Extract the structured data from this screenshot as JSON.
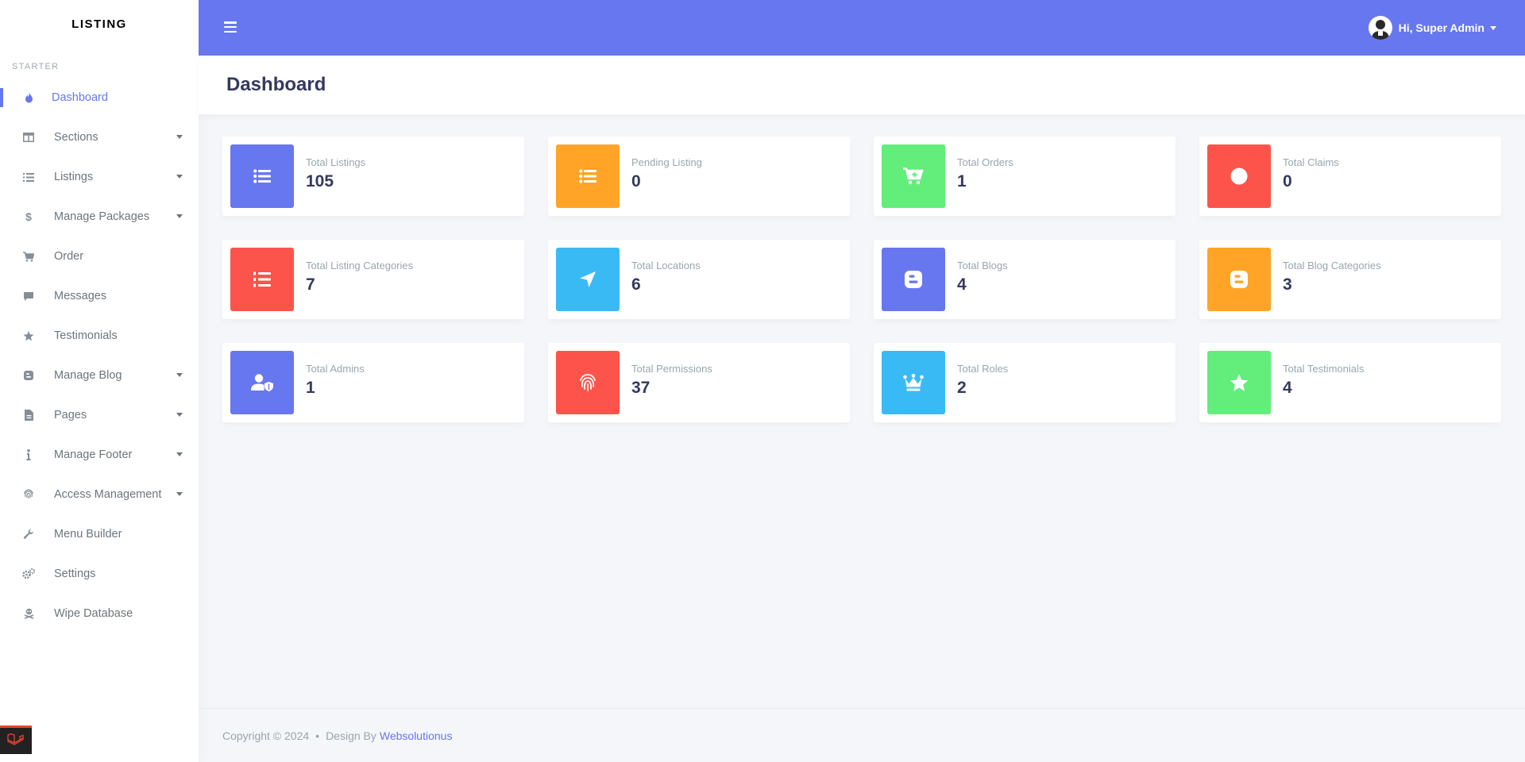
{
  "brand": "LISTING",
  "sidebar": {
    "header": "STARTER",
    "items": [
      {
        "label": "Dashboard",
        "icon": "fire-icon",
        "active": true,
        "dropdown": false
      },
      {
        "label": "Sections",
        "icon": "columns-icon",
        "dropdown": true
      },
      {
        "label": "Listings",
        "icon": "list-icon",
        "dropdown": true
      },
      {
        "label": "Manage Packages",
        "icon": "dollar-icon",
        "dropdown": true
      },
      {
        "label": "Order",
        "icon": "cart-icon",
        "dropdown": false
      },
      {
        "label": "Messages",
        "icon": "comment-icon",
        "dropdown": false
      },
      {
        "label": "Testimonials",
        "icon": "star-icon",
        "dropdown": false
      },
      {
        "label": "Manage Blog",
        "icon": "blog-icon",
        "dropdown": true
      },
      {
        "label": "Pages",
        "icon": "file-icon",
        "dropdown": true
      },
      {
        "label": "Manage Footer",
        "icon": "info-icon",
        "dropdown": true
      },
      {
        "label": "Access Management",
        "icon": "fingerprint-icon",
        "dropdown": true
      },
      {
        "label": "Menu Builder",
        "icon": "wrench-icon",
        "dropdown": false
      },
      {
        "label": "Settings",
        "icon": "cogs-icon",
        "dropdown": false
      },
      {
        "label": "Wipe Database",
        "icon": "skull-icon",
        "dropdown": false
      }
    ]
  },
  "navbar": {
    "greeting": "Hi, Super Admin"
  },
  "page": {
    "title": "Dashboard"
  },
  "cards": [
    {
      "label": "Total Listings",
      "value": "105",
      "color": "#6777ef",
      "icon": "list-icon"
    },
    {
      "label": "Pending Listing",
      "value": "0",
      "color": "#ffa426",
      "icon": "list-icon"
    },
    {
      "label": "Total Orders",
      "value": "1",
      "color": "#63ed7a",
      "icon": "cart-plus-icon"
    },
    {
      "label": "Total Claims",
      "value": "0",
      "color": "#fc544b",
      "icon": "circle-icon"
    },
    {
      "label": "Total Listing Categories",
      "value": "7",
      "color": "#fc544b",
      "icon": "list-ol-icon"
    },
    {
      "label": "Total Locations",
      "value": "6",
      "color": "#3abaf4",
      "icon": "location-arrow-icon"
    },
    {
      "label": "Total Blogs",
      "value": "4",
      "color": "#6777ef",
      "icon": "blogger-icon"
    },
    {
      "label": "Total Blog Categories",
      "value": "3",
      "color": "#ffa426",
      "icon": "blogger-icon"
    },
    {
      "label": "Total Admins",
      "value": "1",
      "color": "#6777ef",
      "icon": "user-shield-icon"
    },
    {
      "label": "Total Permissions",
      "value": "37",
      "color": "#fc544b",
      "icon": "fingerprint-icon"
    },
    {
      "label": "Total Roles",
      "value": "2",
      "color": "#3abaf4",
      "icon": "crown-icon"
    },
    {
      "label": "Total Testimonials",
      "value": "4",
      "color": "#63ed7a",
      "icon": "star-icon"
    }
  ],
  "footer": {
    "copyright": "Copyright © 2024",
    "bullet": "•",
    "design_by": "Design By",
    "link": "Websolutionus"
  }
}
